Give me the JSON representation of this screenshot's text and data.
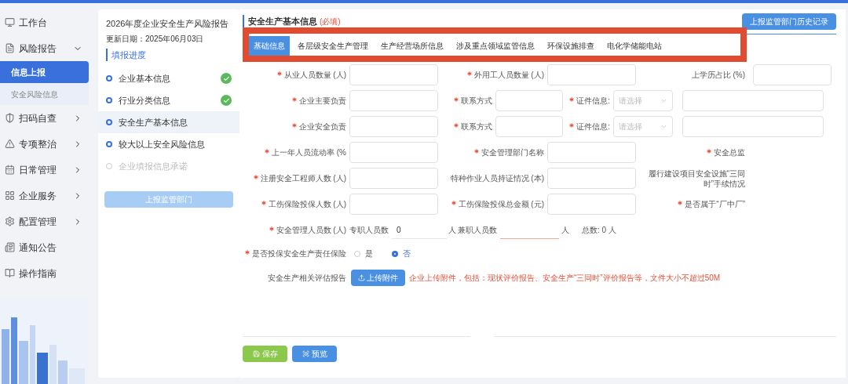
{
  "sidebar": {
    "items": [
      {
        "label": "工作台"
      },
      {
        "label": "风险报告",
        "expanded": true,
        "children": [
          {
            "label": "信息上报",
            "selected": true
          },
          {
            "label": "安全风险信息",
            "selected": false
          }
        ]
      },
      {
        "label": "扫码自查",
        "expanded": false
      },
      {
        "label": "专项整治",
        "expanded": false
      },
      {
        "label": "日常管理",
        "expanded": false
      },
      {
        "label": "企业服务",
        "expanded": false
      },
      {
        "label": "配置管理",
        "expanded": false
      },
      {
        "label": "通知公告"
      },
      {
        "label": "操作指南"
      }
    ]
  },
  "progress": {
    "title": "2026年度企业安全生产风险报告",
    "updated": "更新日期：2025年06月03日",
    "heading": "填报进度",
    "steps": [
      {
        "label": "企业基本信息",
        "done": true,
        "selected": false,
        "disabled": false
      },
      {
        "label": "行业分类信息",
        "done": true,
        "selected": false,
        "disabled": false
      },
      {
        "label": "安全生产基本信息",
        "done": false,
        "selected": true,
        "disabled": false
      },
      {
        "label": "较大以上安全风险信息",
        "done": false,
        "selected": false,
        "disabled": false
      },
      {
        "label": "企业填报信息承诺",
        "done": false,
        "selected": false,
        "disabled": true
      }
    ],
    "submit_button": {
      "label": "上报监管部门",
      "disabled": true
    }
  },
  "main": {
    "title": "安全生产基本信息",
    "required_note": "(必填)",
    "history_button": "上报监管部门历史记录",
    "tabs": [
      {
        "label": "基础信息",
        "selected": true
      },
      {
        "label": "各层级安全生产管理",
        "selected": false
      },
      {
        "label": "生产经营场所信息",
        "selected": false
      },
      {
        "label": "涉及重点领域监管信息",
        "selected": false
      },
      {
        "label": "环保设施排查",
        "selected": false
      },
      {
        "label": "电化学储能电站",
        "selected": false
      }
    ],
    "rows": [
      {
        "kind": "triple",
        "fields": [
          {
            "label": "从业人员数量 (人)",
            "required": true,
            "input": true
          },
          {
            "label": "外用工人员数量 (人)",
            "required": true,
            "input": true
          },
          {
            "label": "上学历占比 (%)",
            "required": false,
            "input": true
          }
        ]
      },
      {
        "kind": "contact",
        "fields": [
          {
            "label": "企业主要负责",
            "required": true,
            "input": true
          },
          {
            "label": "联系方式",
            "required": true,
            "input": true
          },
          {
            "label": "证件信息:",
            "required": true,
            "select_placeholder": "请选择"
          },
          {
            "input": true
          }
        ]
      },
      {
        "kind": "contact",
        "fields": [
          {
            "label": "企业安全负责",
            "required": true,
            "input": true
          },
          {
            "label": "联系方式",
            "required": true,
            "input": true
          },
          {
            "label": "证件信息:",
            "required": true,
            "select_placeholder": "请选择"
          },
          {
            "input": true
          }
        ]
      },
      {
        "kind": "triple",
        "fields": [
          {
            "label": "上一年人员流动率 (%",
            "required": true,
            "input": true
          },
          {
            "label": "安全管理部门名称",
            "required": true,
            "input": true
          },
          {
            "label": "安全总监",
            "required": true,
            "input": false
          }
        ]
      },
      {
        "kind": "triple",
        "fields": [
          {
            "label": "注册安全工程师人数 (人)",
            "required": true,
            "input": true
          },
          {
            "label": "特种作业人员持证情况 (本)",
            "required": false,
            "input": true
          },
          {
            "label": "履行建设项目安全设施“三同时”手续情况",
            "required": false,
            "input": false
          }
        ]
      },
      {
        "kind": "triple",
        "fields": [
          {
            "label": "工伤保险投保人数 (人)",
            "required": true,
            "input": true
          },
          {
            "label": "工伤保险投保总金额 (元)",
            "required": true,
            "input": true
          },
          {
            "label": "是否属于“厂中厂”",
            "required": true,
            "input": false
          }
        ]
      }
    ],
    "staff": {
      "label": "安全管理人员数 (人)",
      "required": true,
      "fulltime_label": "专职人员数",
      "fulltime_value": "0",
      "unit1": "人",
      "parttime_label": "兼职人员数",
      "unit2": "人",
      "total": "总数: 0 人"
    },
    "insurance": {
      "label": "是否投保安全生产责任保险",
      "required": true,
      "options": [
        {
          "label": "是",
          "selected": false
        },
        {
          "label": "否",
          "selected": true
        }
      ]
    },
    "report": {
      "label": "安全生产相关评估报告",
      "required": false,
      "upload_button": "上传附件",
      "hint": "企业上传附件，包括：现状评价报告、安全生产“三同时”评价报告等，文件大小不超过50M"
    },
    "save_button": "保存",
    "preview_button": "预览"
  }
}
